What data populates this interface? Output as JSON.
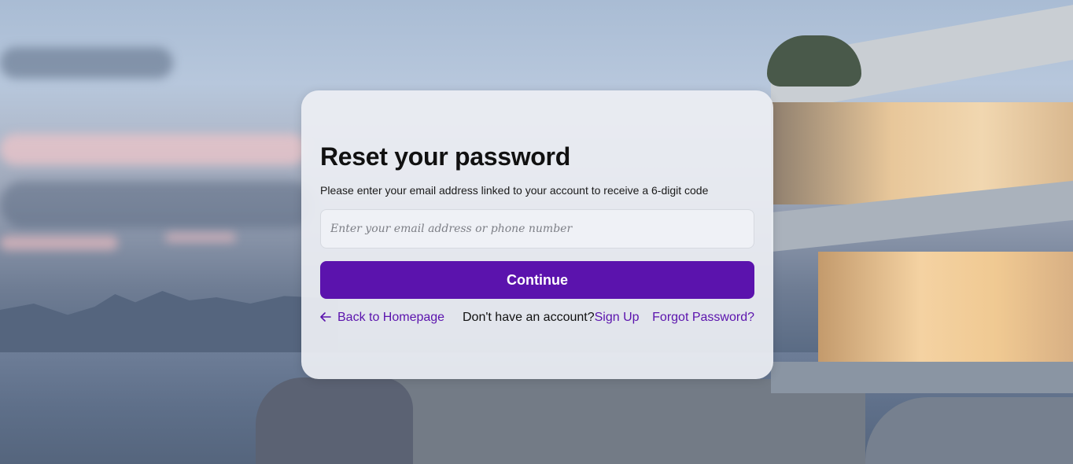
{
  "reset_card": {
    "title": "Reset your password",
    "subtitle": "Please enter your email address linked to your account to receive a 6-digit code",
    "email_field": {
      "value": "",
      "placeholder": "Enter your email address or phone number"
    },
    "continue_label": "Continue",
    "back_link": {
      "icon": "arrow-left-icon",
      "label": "Back to Homepage"
    },
    "account_prompt": "Don't have an account?",
    "signup_label": "Sign Up",
    "forgot_label": "Forgot Password?"
  },
  "colors": {
    "accent": "#5b13ad",
    "card_background": "#eceef3",
    "text": "#111111"
  }
}
